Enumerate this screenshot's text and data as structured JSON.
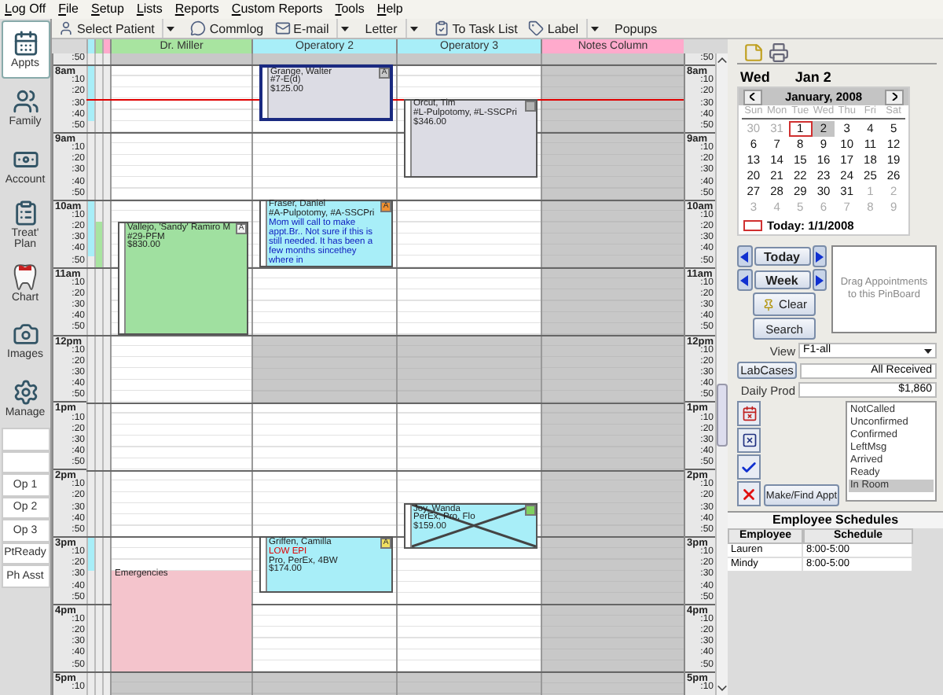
{
  "menu": [
    "Log Off",
    "File",
    "Setup",
    "Lists",
    "Reports",
    "Custom Reports",
    "Tools",
    "Help"
  ],
  "toolbar": [
    {
      "label": "Select Patient",
      "dropdown": true
    },
    {
      "label": "Commlog",
      "dropdown": false
    },
    {
      "label": "E-mail",
      "dropdown": true
    },
    {
      "label": "Letter",
      "dropdown": true
    },
    {
      "label": "To Task List",
      "dropdown": false
    },
    {
      "label": "Label",
      "dropdown": true
    },
    {
      "label": "Popups",
      "dropdown": false
    }
  ],
  "modules": [
    {
      "label": "Appts",
      "selected": true
    },
    {
      "label": "Family",
      "selected": false
    },
    {
      "label": "Account",
      "selected": false
    },
    {
      "label": "Treat' Plan",
      "selected": false
    },
    {
      "label": "Chart",
      "selected": false
    },
    {
      "label": "Images",
      "selected": false
    },
    {
      "label": "Manage",
      "selected": false
    }
  ],
  "views": [
    "Op 1",
    "Op 2",
    "Op 3",
    "PtReady",
    "Ph Asst"
  ],
  "schedule": {
    "provider_bars": [
      {
        "color": "#a8eef8"
      },
      {
        "color": "#a8e4a0"
      },
      {
        "color": "#ffaacc"
      }
    ],
    "time_rows": [
      {
        "left": ":50",
        "right": ":50",
        "kind": "minute"
      },
      {
        "left": "8am",
        "right": "8am",
        "kind": "hour"
      },
      {
        "left": ":10",
        "right": ":10",
        "kind": "minute"
      },
      {
        "left": ":20",
        "right": ":20",
        "kind": "minute"
      },
      {
        "left": ":30",
        "right": ":30",
        "kind": "minute"
      },
      {
        "left": ":40",
        "right": ":40",
        "kind": "minute"
      },
      {
        "left": ":50",
        "right": ":50",
        "kind": "minute"
      },
      {
        "left": "9am",
        "right": "9am",
        "kind": "hour"
      },
      {
        "left": ":10",
        "right": ":10",
        "kind": "minute"
      },
      {
        "left": ":20",
        "right": ":20",
        "kind": "minute"
      },
      {
        "left": ":30",
        "right": ":30",
        "kind": "minute"
      },
      {
        "left": ":40",
        "right": ":40",
        "kind": "minute"
      },
      {
        "left": ":50",
        "right": ":50",
        "kind": "minute"
      },
      {
        "left": "10am",
        "right": "10am",
        "kind": "hour"
      },
      {
        "left": ":10",
        "right": ":10",
        "kind": "minute"
      },
      {
        "left": ":20",
        "right": ":20",
        "kind": "minute"
      },
      {
        "left": ":30",
        "right": ":30",
        "kind": "minute"
      },
      {
        "left": ":40",
        "right": ":40",
        "kind": "minute"
      },
      {
        "left": ":50",
        "right": ":50",
        "kind": "minute"
      },
      {
        "left": "11am",
        "right": "11am",
        "kind": "hour"
      },
      {
        "left": ":10",
        "right": ":10",
        "kind": "minute"
      },
      {
        "left": ":20",
        "right": ":20",
        "kind": "minute"
      },
      {
        "left": ":30",
        "right": ":30",
        "kind": "minute"
      },
      {
        "left": ":40",
        "right": ":40",
        "kind": "minute"
      },
      {
        "left": ":50",
        "right": ":50",
        "kind": "minute"
      },
      {
        "left": "12pm",
        "right": "12pm",
        "kind": "hour"
      },
      {
        "left": ":10",
        "right": ":10",
        "kind": "minute"
      },
      {
        "left": ":20",
        "right": ":20",
        "kind": "minute"
      },
      {
        "left": ":30",
        "right": ":30",
        "kind": "minute"
      },
      {
        "left": ":40",
        "right": ":40",
        "kind": "minute"
      },
      {
        "left": ":50",
        "right": ":50",
        "kind": "minute"
      },
      {
        "left": "1pm",
        "right": "1pm",
        "kind": "hour"
      },
      {
        "left": ":10",
        "right": ":10",
        "kind": "minute"
      },
      {
        "left": ":20",
        "right": ":20",
        "kind": "minute"
      },
      {
        "left": ":30",
        "right": ":30",
        "kind": "minute"
      },
      {
        "left": ":40",
        "right": ":40",
        "kind": "minute"
      },
      {
        "left": ":50",
        "right": ":50",
        "kind": "minute"
      },
      {
        "left": "2pm",
        "right": "2pm",
        "kind": "hour"
      },
      {
        "left": ":10",
        "right": ":10",
        "kind": "minute"
      },
      {
        "left": ":20",
        "right": ":20",
        "kind": "minute"
      },
      {
        "left": ":30",
        "right": ":30",
        "kind": "minute"
      },
      {
        "left": ":40",
        "right": ":40",
        "kind": "minute"
      },
      {
        "left": ":50",
        "right": ":50",
        "kind": "minute"
      },
      {
        "left": "3pm",
        "right": "3pm",
        "kind": "hour"
      },
      {
        "left": ":10",
        "right": ":10",
        "kind": "minute"
      },
      {
        "left": ":20",
        "right": ":20",
        "kind": "minute"
      },
      {
        "left": ":30",
        "right": ":30",
        "kind": "minute"
      },
      {
        "left": ":40",
        "right": ":40",
        "kind": "minute"
      },
      {
        "left": ":50",
        "right": ":50",
        "kind": "minute"
      },
      {
        "left": "4pm",
        "right": "4pm",
        "kind": "hour"
      },
      {
        "left": ":10",
        "right": ":10",
        "kind": "minute"
      },
      {
        "left": ":20",
        "right": ":20",
        "kind": "minute"
      },
      {
        "left": ":30",
        "right": ":30",
        "kind": "minute"
      },
      {
        "left": ":40",
        "right": ":40",
        "kind": "minute"
      },
      {
        "left": ":50",
        "right": ":50",
        "kind": "minute"
      },
      {
        "left": "5pm",
        "right": "5pm",
        "kind": "hour"
      },
      {
        "left": ":10",
        "right": ":10",
        "kind": "minute"
      }
    ],
    "columns": [
      {
        "name": "Dr. Miller",
        "color": "#a8e4a0",
        "kind": "provider",
        "lunch_closed": false,
        "appointments": [
          {
            "kind": "appointment",
            "color": "#a0e0a0",
            "selected": false,
            "broken": false,
            "badge": {
              "letter": "A",
              "color": "#f0f0f0"
            },
            "lines": [
              {
                "text": "Vallejo, 'Sandy' Ramiro M",
                "kind": "normal"
              },
              {
                "text": "#29-PFM",
                "kind": "normal"
              },
              {
                "text": "$830.00",
                "kind": "normal"
              }
            ]
          },
          {
            "kind": "blockout",
            "color": "#f4c4cc",
            "lines": [
              {
                "text": "Emergencies",
                "kind": "normal"
              }
            ]
          }
        ]
      },
      {
        "name": "Operatory 2",
        "color": "#a8eef8",
        "kind": "provider",
        "lunch_closed": true,
        "appointments": [
          {
            "kind": "appointment",
            "color": "#dcdce4",
            "selected": true,
            "broken": false,
            "badge": {
              "letter": "A",
              "color": "#c8c8c8"
            },
            "lines": [
              {
                "text": "Grange, Walter",
                "kind": "normal"
              },
              {
                "text": "#7-E(d)",
                "kind": "normal"
              },
              {
                "text": "$125.00",
                "kind": "normal"
              }
            ]
          },
          {
            "kind": "appointment",
            "color": "#a8eef8",
            "selected": false,
            "broken": false,
            "badge": {
              "letter": "A",
              "color": "#f09030"
            },
            "lines": [
              {
                "text": "Fraser, Daniel",
                "kind": "normal"
              },
              {
                "text": "#A-Pulpotomy, #A-SSCPri",
                "kind": "normal"
              },
              {
                "text": "Mom will call to make appt.Br.. Not sure if this is still needed. It has been a few months sincethey where in",
                "kind": "note"
              }
            ]
          },
          {
            "kind": "appointment",
            "color": "#a8eef8",
            "selected": false,
            "broken": false,
            "badge": {
              "letter": "A",
              "color": "#f0e060"
            },
            "lines": [
              {
                "text": "Griffen, Camilla",
                "kind": "normal"
              },
              {
                "text": "LOW EPI",
                "kind": "alert"
              },
              {
                "text": "Pro, PerEx, 4BW",
                "kind": "normal"
              },
              {
                "text": "$174.00",
                "kind": "normal"
              }
            ]
          }
        ]
      },
      {
        "name": "Operatory 3",
        "color": "#a8eef8",
        "kind": "provider",
        "lunch_closed": true,
        "appointments": [
          {
            "kind": "appointment",
            "color": "#dcdce4",
            "selected": false,
            "broken": false,
            "badge": {
              "color": "#b4b4b4"
            },
            "lines": [
              {
                "text": "Orcut, Tim",
                "kind": "normal"
              },
              {
                "text": "#L-Pulpotomy, #L-SSCPri",
                "kind": "normal"
              },
              {
                "text": "$346.00",
                "kind": "normal"
              }
            ]
          },
          {
            "kind": "appointment",
            "color": "#a8eef8",
            "selected": false,
            "broken": true,
            "badge": {
              "color": "#80d060"
            },
            "lines": [
              {
                "text": "Joy, Wanda",
                "kind": "normal"
              },
              {
                "text": "PerEx, Pro, Flo",
                "kind": "normal"
              },
              {
                "text": "$159.00",
                "kind": "normal"
              }
            ]
          }
        ]
      },
      {
        "name": "Notes Column",
        "color": "#ffaacc",
        "kind": "notes"
      }
    ]
  },
  "date_heading": {
    "weekday": "Wed",
    "date": "Jan 2"
  },
  "calendar": {
    "month": "January, 2008",
    "weekdays": [
      "Sun",
      "Mon",
      "Tue",
      "Wed",
      "Thu",
      "Fri",
      "Sat"
    ],
    "days": [
      {
        "label": "30",
        "other_month": true,
        "selected": false,
        "today": false
      },
      {
        "label": "31",
        "other_month": true,
        "selected": false,
        "today": false
      },
      {
        "label": "1",
        "other_month": false,
        "selected": false,
        "today": true
      },
      {
        "label": "2",
        "other_month": false,
        "selected": true,
        "today": false
      },
      {
        "label": "3",
        "other_month": false,
        "selected": false,
        "today": false
      },
      {
        "label": "4",
        "other_month": false,
        "selected": false,
        "today": false
      },
      {
        "label": "5",
        "other_month": false,
        "selected": false,
        "today": false
      },
      {
        "label": "6",
        "other_month": false,
        "selected": false,
        "today": false
      },
      {
        "label": "7",
        "other_month": false,
        "selected": false,
        "today": false
      },
      {
        "label": "8",
        "other_month": false,
        "selected": false,
        "today": false
      },
      {
        "label": "9",
        "other_month": false,
        "selected": false,
        "today": false
      },
      {
        "label": "10",
        "other_month": false,
        "selected": false,
        "today": false
      },
      {
        "label": "11",
        "other_month": false,
        "selected": false,
        "today": false
      },
      {
        "label": "12",
        "other_month": false,
        "selected": false,
        "today": false
      },
      {
        "label": "13",
        "other_month": false,
        "selected": false,
        "today": false
      },
      {
        "label": "14",
        "other_month": false,
        "selected": false,
        "today": false
      },
      {
        "label": "15",
        "other_month": false,
        "selected": false,
        "today": false
      },
      {
        "label": "16",
        "other_month": false,
        "selected": false,
        "today": false
      },
      {
        "label": "17",
        "other_month": false,
        "selected": false,
        "today": false
      },
      {
        "label": "18",
        "other_month": false,
        "selected": false,
        "today": false
      },
      {
        "label": "19",
        "other_month": false,
        "selected": false,
        "today": false
      },
      {
        "label": "20",
        "other_month": false,
        "selected": false,
        "today": false
      },
      {
        "label": "21",
        "other_month": false,
        "selected": false,
        "today": false
      },
      {
        "label": "22",
        "other_month": false,
        "selected": false,
        "today": false
      },
      {
        "label": "23",
        "other_month": false,
        "selected": false,
        "today": false
      },
      {
        "label": "24",
        "other_month": false,
        "selected": false,
        "today": false
      },
      {
        "label": "25",
        "other_month": false,
        "selected": false,
        "today": false
      },
      {
        "label": "26",
        "other_month": false,
        "selected": false,
        "today": false
      },
      {
        "label": "27",
        "other_month": false,
        "selected": false,
        "today": false
      },
      {
        "label": "28",
        "other_month": false,
        "selected": false,
        "today": false
      },
      {
        "label": "29",
        "other_month": false,
        "selected": false,
        "today": false
      },
      {
        "label": "30",
        "other_month": false,
        "selected": false,
        "today": false
      },
      {
        "label": "31",
        "other_month": false,
        "selected": false,
        "today": false
      },
      {
        "label": "1",
        "other_month": true,
        "selected": false,
        "today": false
      },
      {
        "label": "2",
        "other_month": true,
        "selected": false,
        "today": false
      },
      {
        "label": "3",
        "other_month": true,
        "selected": false,
        "today": false
      },
      {
        "label": "4",
        "other_month": true,
        "selected": false,
        "today": false
      },
      {
        "label": "5",
        "other_month": true,
        "selected": false,
        "today": false
      },
      {
        "label": "6",
        "other_month": true,
        "selected": false,
        "today": false
      },
      {
        "label": "7",
        "other_month": true,
        "selected": false,
        "today": false
      },
      {
        "label": "8",
        "other_month": true,
        "selected": false,
        "today": false
      },
      {
        "label": "9",
        "other_month": true,
        "selected": false,
        "today": false
      }
    ],
    "today_label": "Today: 1/1/2008"
  },
  "nav": {
    "today": "Today",
    "week": "Week",
    "clear": "Clear",
    "search": "Search",
    "pinboard": "Drag Appointments to this PinBoard"
  },
  "view": {
    "label": "View",
    "value": "F1-all"
  },
  "lab_cases": {
    "button": "LabCases",
    "value": "All Received"
  },
  "daily_prod": {
    "label": "Daily Prod",
    "value": "$1,860"
  },
  "make_appt": "Make/Find Appt",
  "confirm_statuses": [
    {
      "label": "NotCalled",
      "selected": false
    },
    {
      "label": "Unconfirmed",
      "selected": false
    },
    {
      "label": "Confirmed",
      "selected": false
    },
    {
      "label": "LeftMsg",
      "selected": false
    },
    {
      "label": "Arrived",
      "selected": false
    },
    {
      "label": "Ready",
      "selected": false
    },
    {
      "label": "In Room",
      "selected": true
    }
  ],
  "employee_schedules": {
    "title": "Employee Schedules",
    "columns": [
      "Employee",
      "Schedule"
    ],
    "rows": [
      [
        "Lauren",
        "8:00-5:00"
      ],
      [
        "Mindy",
        "8:00-5:00"
      ]
    ]
  }
}
